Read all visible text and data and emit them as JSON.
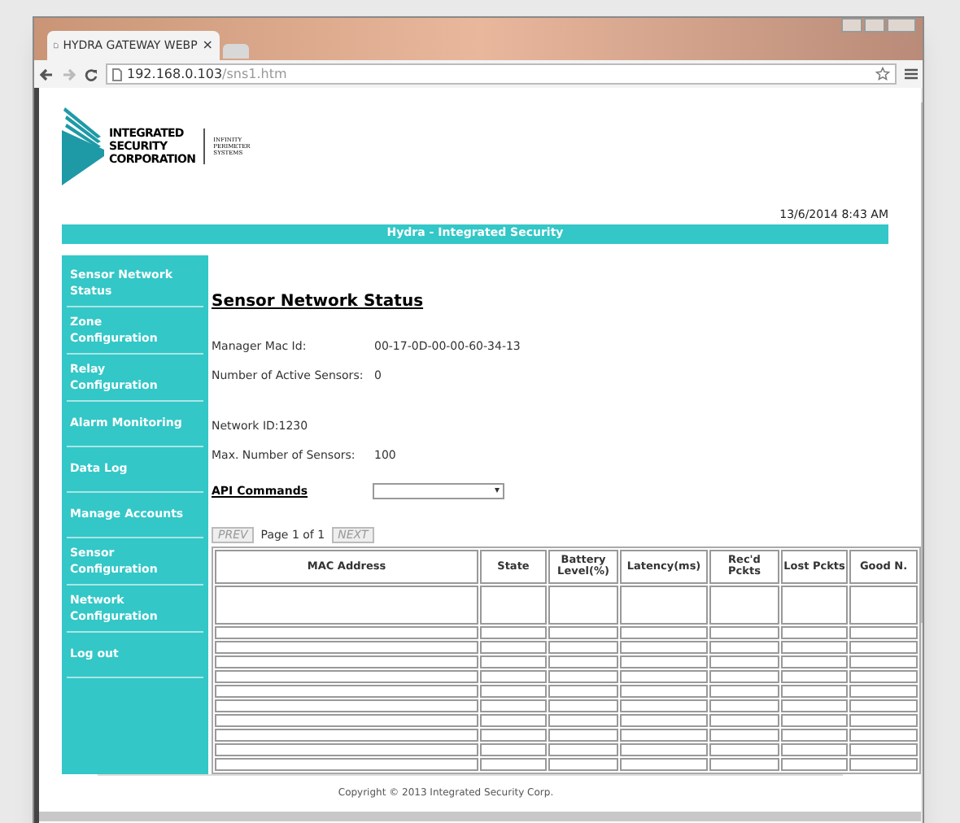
{
  "browser": {
    "tab_title": "HYDRA GATEWAY WEBP",
    "tab_close": "×",
    "url_host": "192.168.0.103",
    "url_path": "/sns1.htm"
  },
  "logo": {
    "company": [
      "INTEGRATED",
      "SECURITY",
      "CORPORATION"
    ],
    "tagline": [
      "INFINITY",
      "PERIMETER",
      "SYSTEMS"
    ]
  },
  "datetime": "13/6/2014 8:43 AM",
  "banner": "Hydra - Integrated Security",
  "nav": [
    {
      "label": "Sensor Network Status"
    },
    {
      "label": "Zone Configuration"
    },
    {
      "label": "Relay Configuration"
    },
    {
      "label": "Alarm Monitoring"
    },
    {
      "label": "Data Log"
    },
    {
      "label": "Manage Accounts"
    },
    {
      "label": "Sensor Configuration"
    },
    {
      "label": "Network Configuration"
    },
    {
      "label": "Log out"
    }
  ],
  "heading": "Sensor Network Status",
  "fields": [
    {
      "label": "Manager Mac Id:",
      "value": "00-17-0D-00-00-60-34-13"
    },
    {
      "label": "Number of Active Sensors:",
      "value": "0"
    },
    {
      "label": "Network ID:1230",
      "gap": true
    },
    {
      "label": "Max. Number of Sensors:",
      "value": "100"
    }
  ],
  "api_commands": {
    "label": "API Commands",
    "arrow": "▾"
  },
  "pager": {
    "prev": "PREV",
    "page": "Page 1 of 1",
    "next": "NEXT"
  },
  "table": {
    "columns": [
      "MAC Address",
      "State",
      "Battery Level(%)",
      "Latency(ms)",
      "Rec'd Pckts",
      "Lost Pckts",
      "Good N."
    ]
  },
  "footer": "Copyright © 2013 Integrated Security Corp."
}
